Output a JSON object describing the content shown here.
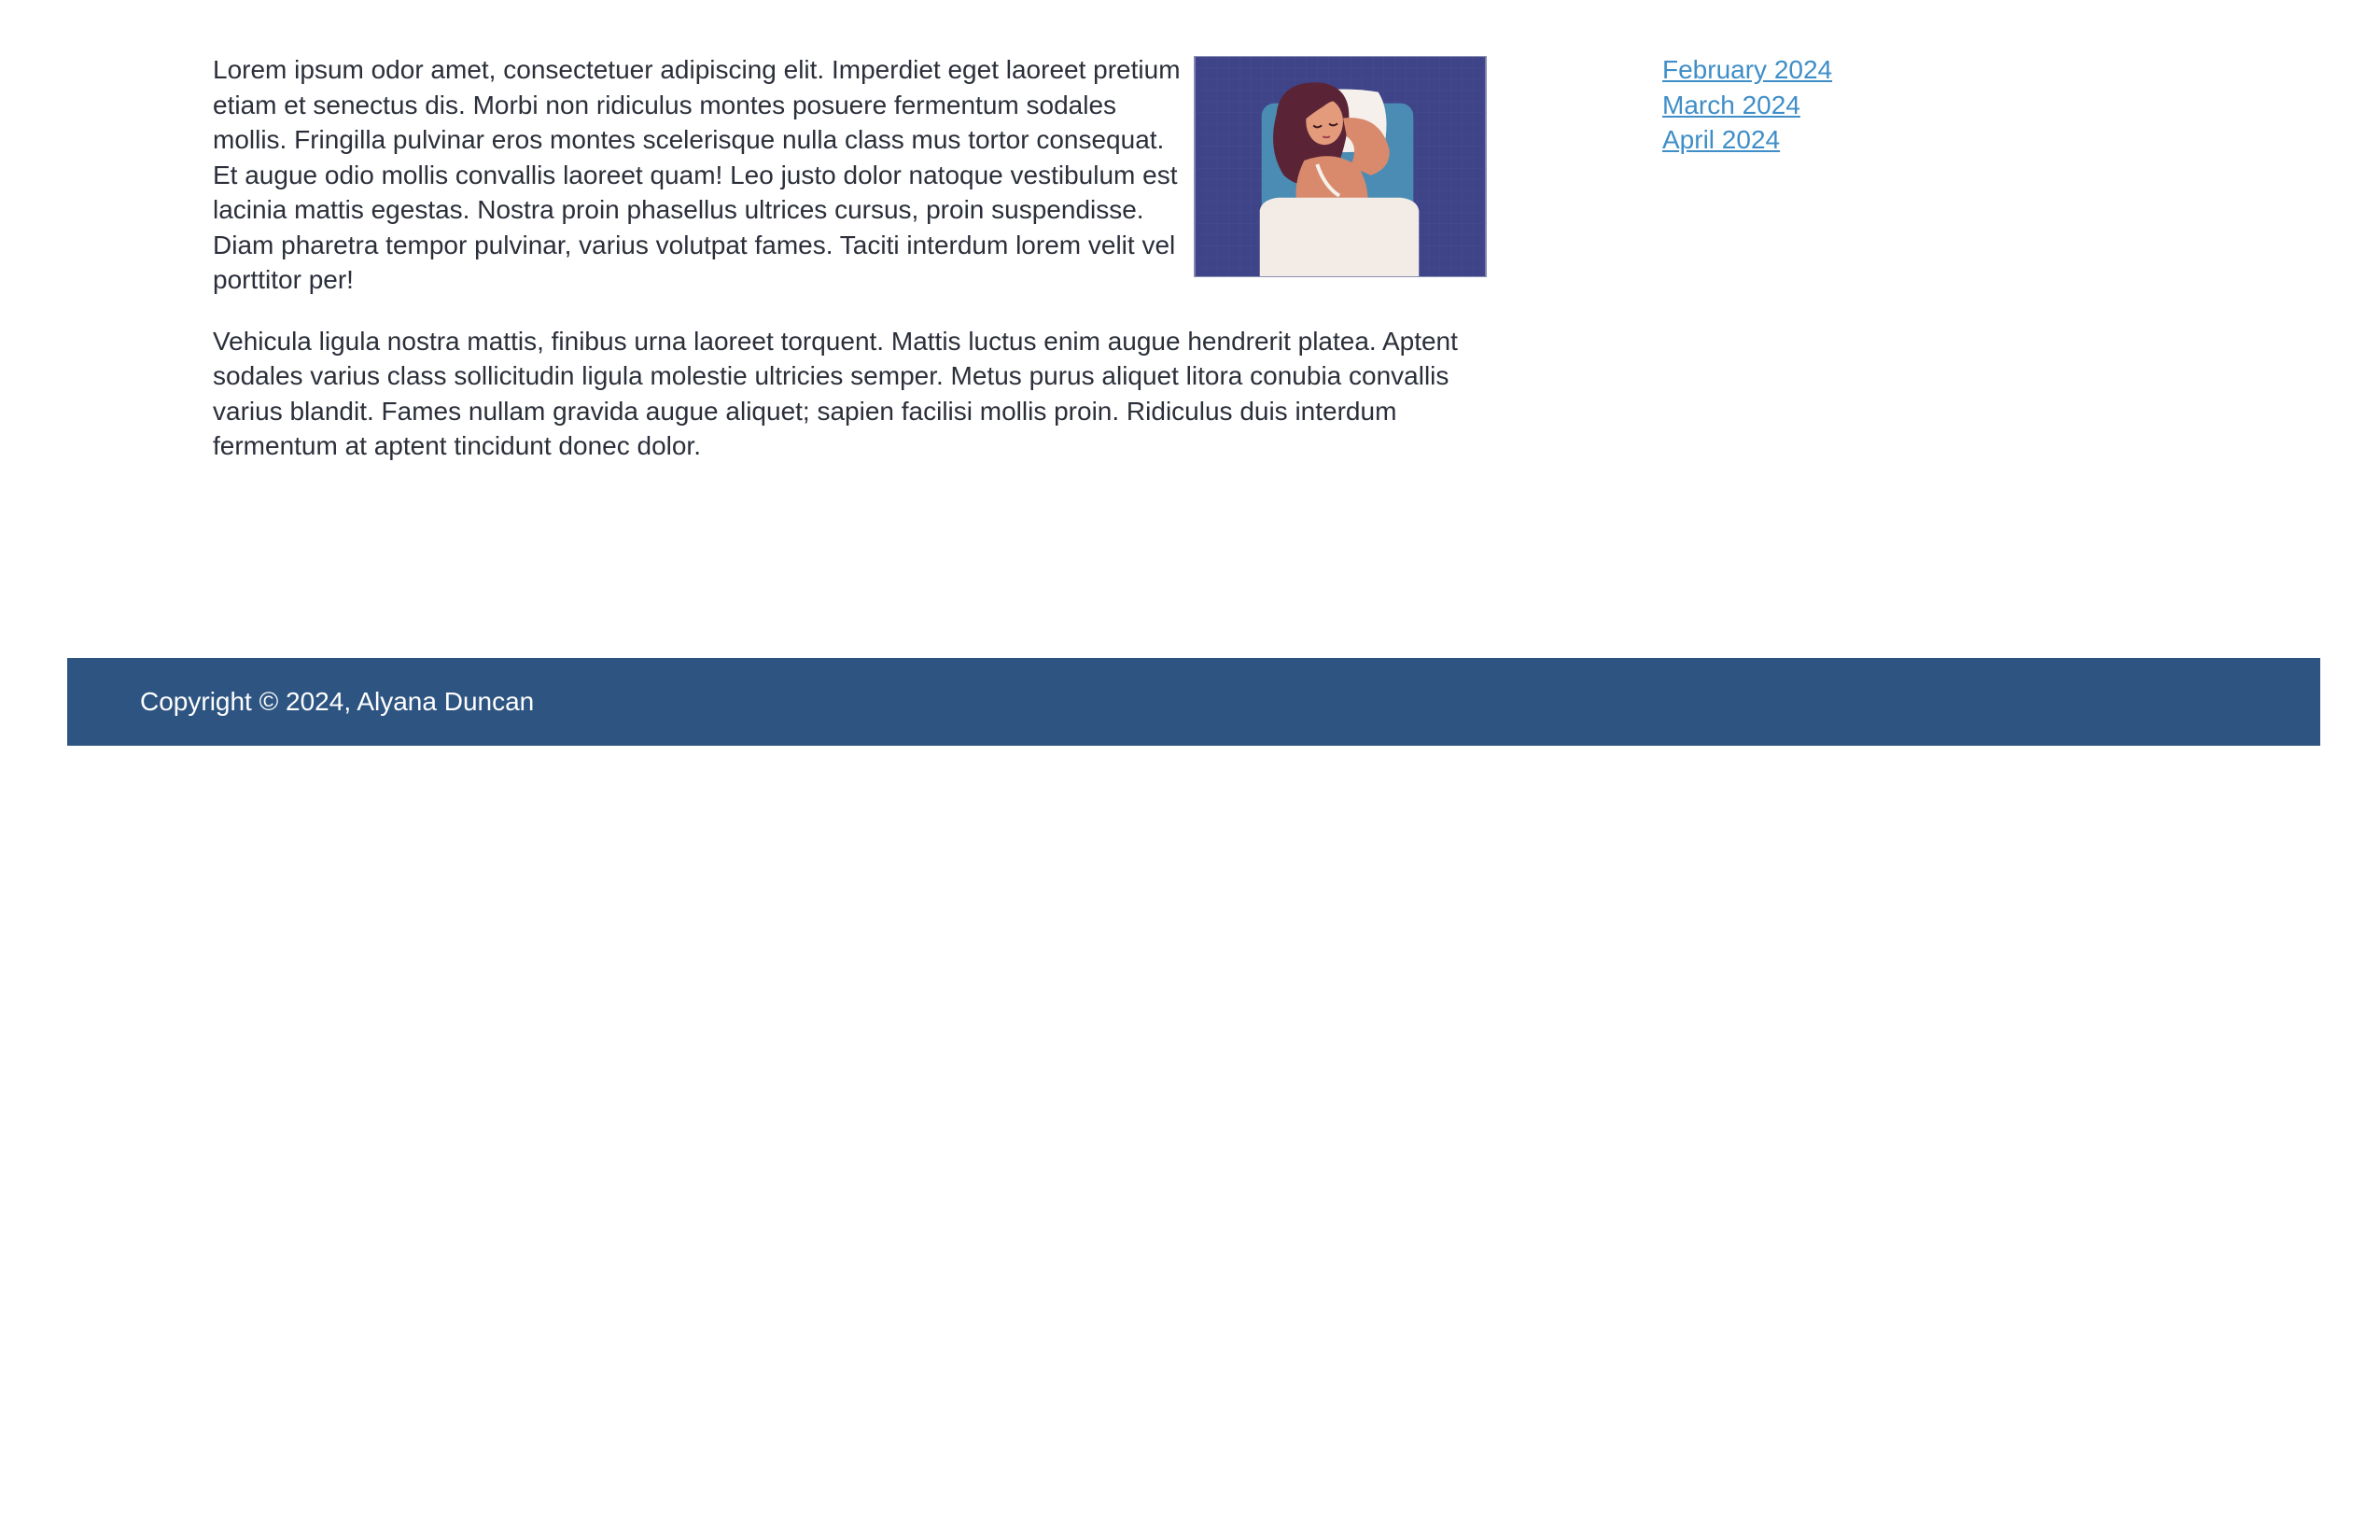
{
  "article": {
    "paragraph_1": "Lorem ipsum odor amet, consectetuer adipiscing elit. Imperdiet eget laoreet pretium etiam et senectus dis. Morbi non ridiculus montes posuere fermentum sodales mollis. Fringilla pulvinar eros montes scelerisque nulla class mus tortor consequat. Et augue odio mollis convallis laoreet quam! Leo justo dolor natoque vestibulum est lacinia mattis egestas. Nostra proin phasellus ultrices cursus, proin suspendisse. Diam pharetra tempor pulvinar, varius volutpat fames. Taciti interdum lorem velit vel porttitor per!",
    "paragraph_2": "Vehicula ligula nostra mattis, finibus urna laoreet torquent. Mattis luctus enim augue hendrerit platea. Aptent sodales varius class sollicitudin ligula molestie ultricies semper. Metus purus aliquet litora conubia convallis varius blandit. Fames nullam gravida augue aliquet; sapien facilisi mollis proin. Ridiculus duis interdum fermentum at aptent tincidunt donec dolor.",
    "image_icon": "sleeping-woman-illustration"
  },
  "sidebar": {
    "archive_links": [
      {
        "label": "February 2024"
      },
      {
        "label": "March 2024"
      },
      {
        "label": "April 2024"
      }
    ],
    "link_color": "#3f8ec7"
  },
  "footer": {
    "copyright": "Copyright © 2024, Alyana Duncan",
    "background_color": "#2e5482"
  }
}
